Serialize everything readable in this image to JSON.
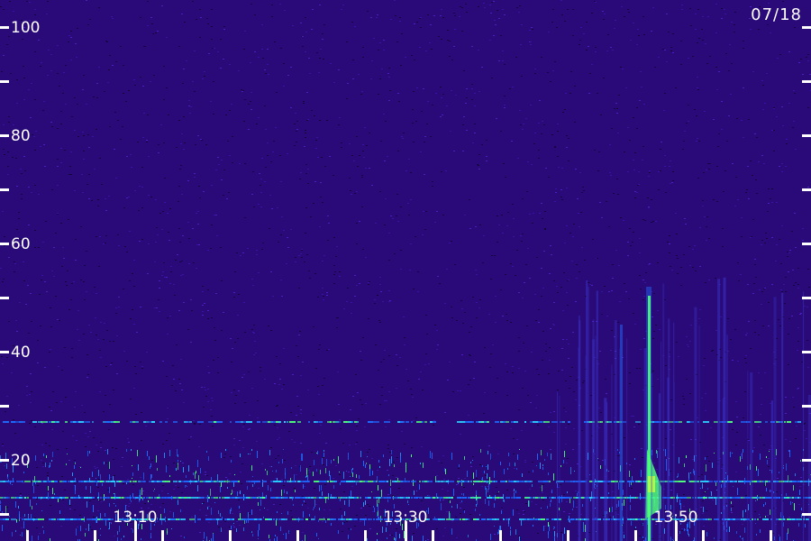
{
  "date": "07/18",
  "chart_data": {
    "type": "heatmap",
    "title": "",
    "xlabel": "",
    "ylabel": "",
    "x_ticks": [
      "13:10",
      "13:30",
      "13:50"
    ],
    "y_ticks": [
      20,
      40,
      60,
      80,
      100
    ],
    "ylim": [
      0,
      100
    ],
    "xlim": [
      "13:00",
      "14:00"
    ],
    "colors": {
      "background": "#2a0a78",
      "low": "#3a14a8",
      "mid": "#1e6cff",
      "high": "#4dff7a",
      "peak": "#c8ff3c",
      "axis": "#ffffff"
    },
    "bands": [
      {
        "freq": 27,
        "intensity": 0.55,
        "from": "13:00",
        "to": "14:00"
      },
      {
        "freq": 16,
        "intensity": 0.85,
        "from": "13:00",
        "to": "14:00"
      },
      {
        "freq": 13,
        "intensity": 0.9,
        "from": "13:00",
        "to": "14:00"
      },
      {
        "freq": 9,
        "intensity": 0.7,
        "from": "13:00",
        "to": "14:00"
      },
      {
        "freq": 3,
        "intensity": 0.6,
        "from": "13:00",
        "to": "14:00"
      }
    ],
    "events": [
      {
        "time": "13:48",
        "freq_min": 5,
        "freq_max": 52,
        "intensity": 1.0
      },
      {
        "time": "13:46",
        "freq_min": 5,
        "freq_max": 45,
        "intensity": 0.45
      }
    ]
  }
}
